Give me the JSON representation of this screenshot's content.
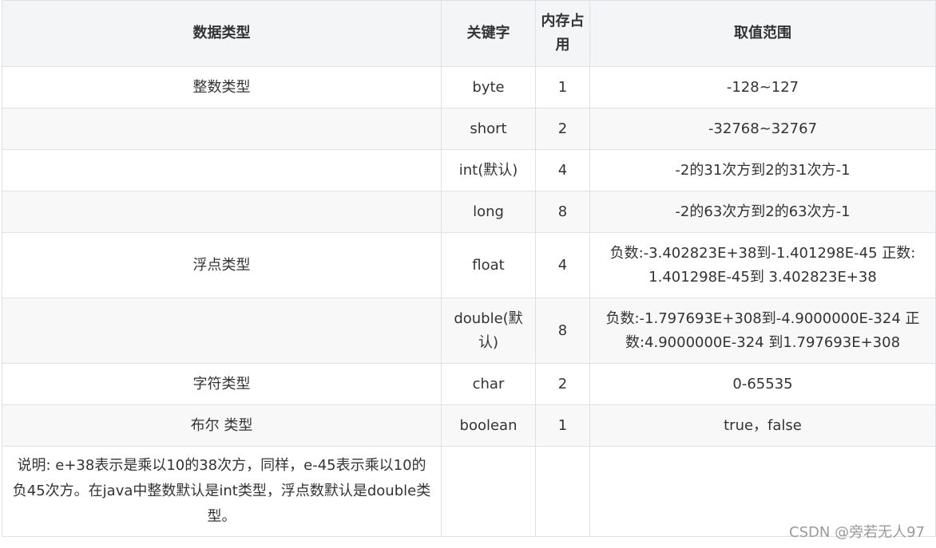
{
  "table": {
    "headers": {
      "type": "数据类型",
      "keyword": "关键字",
      "memory": "内存占用",
      "range": "取值范围"
    },
    "rows": [
      {
        "type": "整数类型",
        "keyword": "byte",
        "memory": "1",
        "range": "-128~127"
      },
      {
        "type": "",
        "keyword": "short",
        "memory": "2",
        "range": "-32768~32767"
      },
      {
        "type": "",
        "keyword": "int(默认)",
        "memory": "4",
        "range": "-2的31次方到2的31次方-1"
      },
      {
        "type": "",
        "keyword": "long",
        "memory": "8",
        "range": "-2的63次方到2的63次方-1"
      },
      {
        "type": "浮点类型",
        "keyword": "float",
        "memory": "4",
        "range": "负数:-3.402823E+38到-1.401298E-45 正数: 1.401298E-45到 3.402823E+38"
      },
      {
        "type": "",
        "keyword": "double(默认)",
        "memory": "8",
        "range": "负数:-1.797693E+308到-4.9000000E-324 正数:4.9000000E-324 到1.797693E+308"
      },
      {
        "type": "字符类型",
        "keyword": "char",
        "memory": "2",
        "range": "0-65535"
      },
      {
        "type": "布尔 类型",
        "keyword": "boolean",
        "memory": "1",
        "range": "true，false"
      }
    ],
    "note": "说明: e+38表示是乘以10的38次方，同样，e-45表示乘以10的负45次方。在java中整数默认是int类型，浮点数默认是double类型。"
  },
  "watermark": "CSDN @旁若无人97"
}
